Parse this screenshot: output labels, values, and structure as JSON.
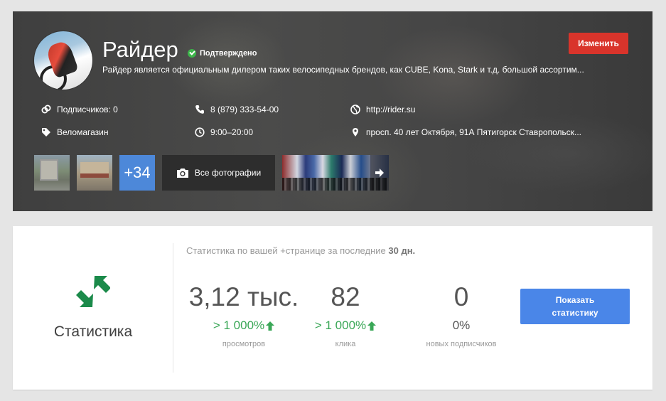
{
  "profile": {
    "name": "Райдер",
    "verified_label": "Подтверждено",
    "description": "Райдер является официальным дилером таких велосипедных брендов, как CUBE, Kona, Stark и т.д. большой ассортим...",
    "edit_label": "Изменить",
    "followers": "Подписчиков: 0",
    "phone": "8 (879) 333-54-00",
    "website": "http://rider.su",
    "category": "Веломагазин",
    "hours": "9:00–20:00",
    "address": "просп. 40 лет Октября, 91А Пятигорск Ставропольск...",
    "photos": {
      "more_count": "+34",
      "all_photos_label": "Все фотографии"
    }
  },
  "stats": {
    "label": "Статистика",
    "period_prefix": "Статистика по вашей +странице за последние",
    "period_value": "30 дн.",
    "metrics": [
      {
        "value": "3,12 тыс.",
        "change": "> 1 000%",
        "caption": "просмотров",
        "trend": "up"
      },
      {
        "value": "82",
        "change": "> 1 000%",
        "caption": "клика",
        "trend": "up"
      },
      {
        "value": "0",
        "change": "0%",
        "caption": "новых подписчиков",
        "trend": "none"
      }
    ],
    "show_button_label": "Показать статистику"
  },
  "colors": {
    "edit_button": "#d9342b",
    "show_button": "#4a86e8",
    "more_photos_tile": "#4d88d9",
    "positive": "#3aa757",
    "stats_icon": "#1b8a4a",
    "verified": "#3cb54a"
  },
  "icons": [
    "check-icon",
    "people-icon",
    "phone-icon",
    "globe-icon",
    "tag-icon",
    "clock-icon",
    "map-pin-icon",
    "camera-icon",
    "arrow-right-icon",
    "stats-arrows-icon",
    "up-arrow-icon"
  ]
}
